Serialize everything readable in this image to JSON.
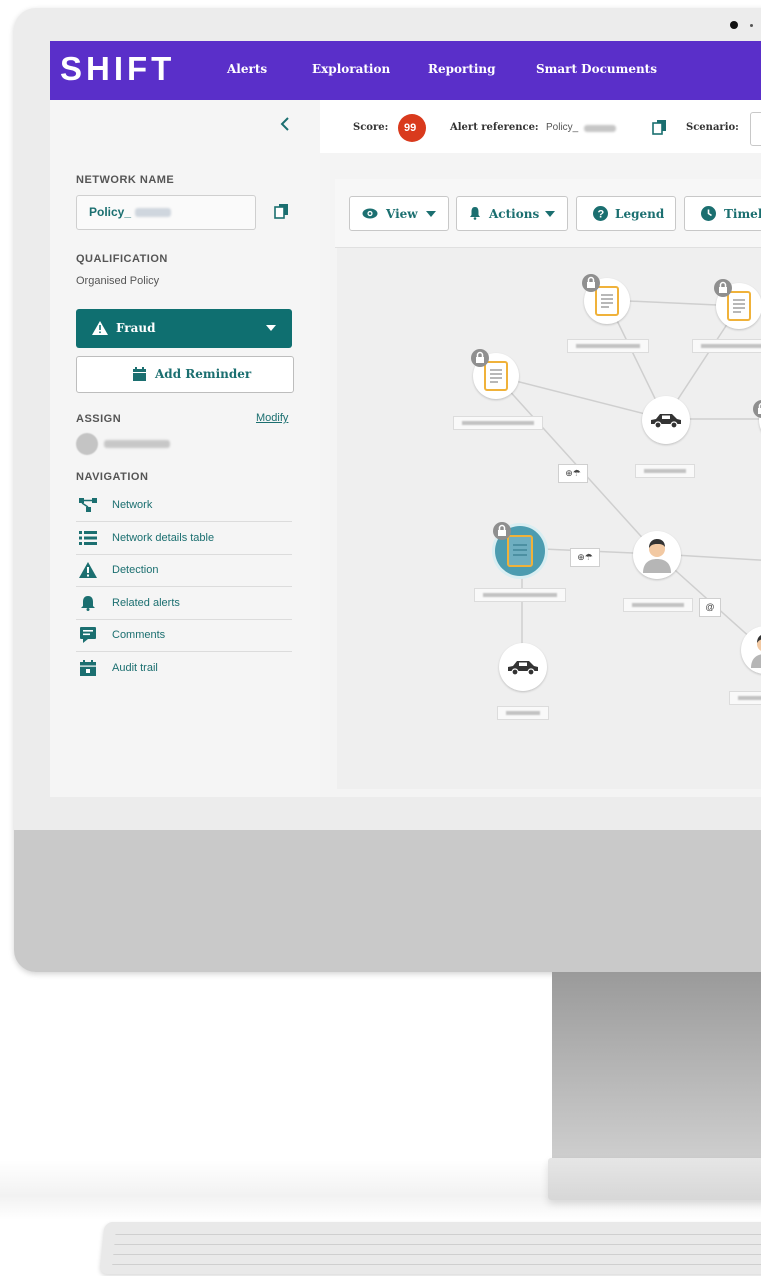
{
  "app": {
    "logo": "SHIFT"
  },
  "nav": [
    "Alerts",
    "Exploration",
    "Reporting",
    "Smart Documents"
  ],
  "sidebar": {
    "network_name_label": "NETWORK NAME",
    "network_name_value": "Policy_",
    "qualification_label": "QUALIFICATION",
    "qualification_value": "Organised Policy",
    "fraud_button": "Fraud",
    "reminder_button": "Add Reminder",
    "assign_label": "ASSIGN",
    "modify_link": "Modify",
    "navigation_label": "NAVIGATION",
    "items": [
      {
        "label": "Network",
        "icon": "network-icon"
      },
      {
        "label": "Network details table",
        "icon": "list-icon"
      },
      {
        "label": "Detection",
        "icon": "warning-icon"
      },
      {
        "label": "Related alerts",
        "icon": "bell-icon"
      },
      {
        "label": "Comments",
        "icon": "comment-icon"
      },
      {
        "label": "Audit trail",
        "icon": "calendar-icon"
      }
    ]
  },
  "infobar": {
    "score_label": "Score:",
    "score_value": "99",
    "alert_ref_label": "Alert reference:",
    "alert_ref_value": "Policy_",
    "scenario_label": "Scenario:"
  },
  "toolbar": {
    "view": "View",
    "actions": "Actions",
    "legend": "Legend",
    "timeline": "Timeli"
  },
  "graph": {
    "edge_icons": [
      "⊕☂",
      "⊕☂",
      "@"
    ]
  },
  "colors": {
    "brand": "#5a2fc9",
    "accent": "#0f6f70",
    "score_badge": "#d93a1d",
    "document": "#f0b23a"
  }
}
